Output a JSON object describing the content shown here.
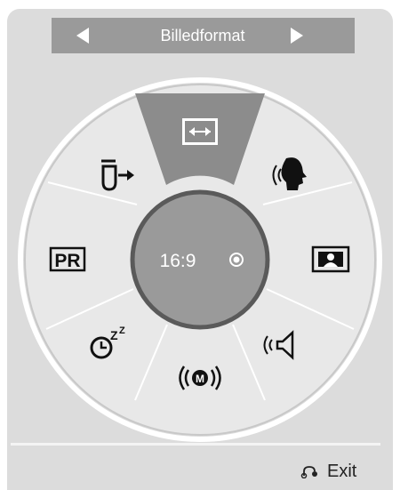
{
  "header": {
    "title": "Billedformat"
  },
  "center": {
    "value": "16:9"
  },
  "menu_items": [
    {
      "name": "aspect-ratio",
      "icon": "aspect-ratio-icon",
      "selected": true
    },
    {
      "name": "voice",
      "icon": "speaking-head-icon"
    },
    {
      "name": "picture",
      "icon": "picture-icon"
    },
    {
      "name": "sound",
      "icon": "speaker-icon"
    },
    {
      "name": "broadcast",
      "icon": "broadcast-m-icon"
    },
    {
      "name": "sleep-timer",
      "icon": "sleep-timer-icon"
    },
    {
      "name": "program",
      "icon": "pr-icon",
      "label": "PR"
    },
    {
      "name": "input",
      "icon": "input-icon"
    }
  ],
  "footer": {
    "exit_label": "Exit",
    "exit_icon": "return-icon"
  },
  "colors": {
    "panel": "#dcdcdc",
    "title_bar": "#9a9a9a",
    "dial_ring": "#e8e8e8",
    "selected_wedge": "#8c8c8c",
    "center_hub": "#9a9a9a",
    "hub_border": "#5a5a5a"
  }
}
